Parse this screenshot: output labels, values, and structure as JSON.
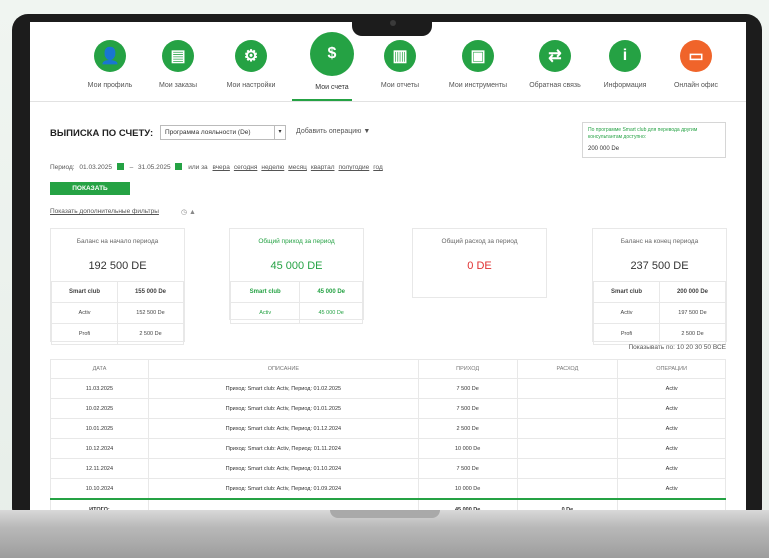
{
  "nav": [
    {
      "label": "Мои профиль",
      "icon": "person-icon",
      "glyph": "👤"
    },
    {
      "label": "Мои заказы",
      "icon": "clipboard-icon",
      "glyph": "▤"
    },
    {
      "label": "Мои настройки",
      "icon": "gears-icon",
      "glyph": "⚙"
    },
    {
      "label": "Мои счета",
      "icon": "money-bag-icon",
      "glyph": "$",
      "active": true
    },
    {
      "label": "Мои отчеты",
      "icon": "bar-chart-icon",
      "glyph": "▥"
    },
    {
      "label": "Мои инструменты",
      "icon": "tools-screen-icon",
      "glyph": "▣"
    },
    {
      "label": "Обратная связь",
      "icon": "arrows-exchange-icon",
      "glyph": "⇄"
    },
    {
      "label": "Информация",
      "icon": "info-icon",
      "glyph": "i"
    },
    {
      "label": "Онлайн офис",
      "icon": "briefcase-icon",
      "glyph": "▭",
      "accent": "#f0642a"
    }
  ],
  "statement": {
    "title": "ВЫПИСКА ПО СЧЕТУ:",
    "program_select": "Программа лояльности (De)",
    "add_operation": "Добавить операцию"
  },
  "info_box": {
    "text": "По программе Smart club для перевода другим консультантам доступно:",
    "value": "200 000 De"
  },
  "period": {
    "label": "Период:",
    "from": "01.03.2025",
    "dash": "–",
    "to": "31.05.2025",
    "or": "или за",
    "quick": [
      "вчера",
      "сегодня",
      "неделю",
      "месяц",
      "квартал",
      "полугодие",
      "год"
    ]
  },
  "show_button": "ПОКАЗАТЬ",
  "filters_link": "Показать дополнительные фильтры",
  "cards": [
    {
      "title": "Баланс на начало периода",
      "amount": "192 500 DE",
      "rows": [
        [
          "Smart club",
          "155 000 De"
        ],
        [
          "Activ",
          "152 500 De"
        ],
        [
          "Profi",
          "2 500 De"
        ]
      ]
    },
    {
      "title": "Общий приход за период",
      "amount": "45 000 DE",
      "rows": [
        [
          "Smart club",
          "45 000 De"
        ],
        [
          "Activ",
          "45 000 De"
        ]
      ]
    },
    {
      "title": "Общий расход за период",
      "amount": "0 DE",
      "rows": []
    },
    {
      "title": "Баланс на конец периода",
      "amount": "237 500 DE",
      "rows": [
        [
          "Smart club",
          "200 000 De"
        ],
        [
          "Activ",
          "197 500 De"
        ],
        [
          "Profi",
          "2 500 De"
        ]
      ]
    }
  ],
  "show_per_page": "Показывать по: 10  20  30  50  ВСЕ",
  "table": {
    "headers": [
      "ДАТА",
      "ОПИСАНИЕ",
      "ПРИХОД",
      "РАСХОД",
      "ОПЕРАЦИИ"
    ],
    "rows": [
      [
        "11.03.2025",
        "Приход: Smart club: Activ, Период: 01.02.2025",
        "7 500 De",
        "",
        "Activ"
      ],
      [
        "10.02.2025",
        "Приход: Smart club: Activ, Период: 01.01.2025",
        "7 500 De",
        "",
        "Activ"
      ],
      [
        "10.01.2025",
        "Приход: Smart club: Activ, Период: 01.12.2024",
        "2 500 De",
        "",
        "Activ"
      ],
      [
        "10.12.2024",
        "Приход: Smart club: Activ, Период: 01.11.2024",
        "10 000 De",
        "",
        "Activ"
      ],
      [
        "12.11.2024",
        "Приход: Smart club: Activ, Период: 01.10.2024",
        "7 500 De",
        "",
        "Activ"
      ],
      [
        "10.10.2024",
        "Приход: Smart club: Activ, Период: 01.09.2024",
        "10 000 De",
        "",
        "Activ"
      ]
    ],
    "total": [
      "ИТОГО:",
      "",
      "45 000 De",
      "0 De",
      ""
    ]
  },
  "colors": {
    "green": "#25a244",
    "orange": "#f0642a",
    "red": "#e03030"
  }
}
